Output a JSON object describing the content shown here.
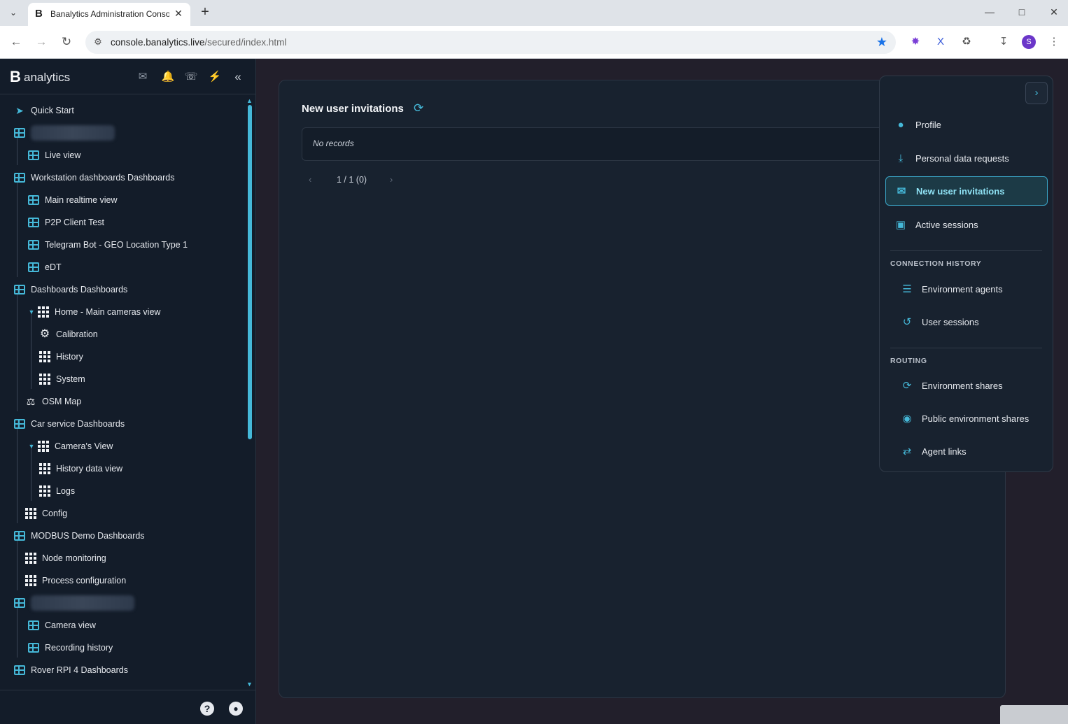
{
  "browser": {
    "tab_title": "Banalytics Administration Conso",
    "tab_favicon": "B",
    "url_host": "console.banalytics.live",
    "url_path": "/secured/index.html",
    "profile_initial": "S"
  },
  "sidebar": {
    "brand_mark": "B",
    "brand_text": "analytics",
    "header_icons": [
      "mail-icon",
      "bell-icon",
      "phone-hangup-icon",
      "plug-icon",
      "collapse-double-chevron-icon"
    ],
    "items": [
      {
        "label": "Quick Start",
        "icon": "rocket-icon"
      },
      {
        "label": "",
        "icon": "table-icon",
        "blurred": true
      },
      {
        "label": "Live view",
        "icon": "table-icon"
      },
      {
        "label": "Workstation dashboards Dashboards",
        "icon": "table-icon"
      },
      {
        "label": "Main realtime view",
        "icon": "table-icon"
      },
      {
        "label": "P2P Client Test",
        "icon": "table-icon"
      },
      {
        "label": "Telegram Bot - GEO Location Type 1",
        "icon": "table-icon"
      },
      {
        "label": "eDT",
        "icon": "table-icon"
      },
      {
        "label": "Dashboards Dashboards",
        "icon": "table-icon"
      },
      {
        "label": "Home - Main cameras view",
        "icon": "grid-icon",
        "expanded": true
      },
      {
        "label": "Calibration",
        "icon": "gear-icon"
      },
      {
        "label": "History",
        "icon": "grid-icon"
      },
      {
        "label": "System",
        "icon": "grid-icon"
      },
      {
        "label": "OSM Map",
        "icon": "map-icon"
      },
      {
        "label": "Car service Dashboards",
        "icon": "table-icon"
      },
      {
        "label": "Camera's View",
        "icon": "grid-icon",
        "expanded": true
      },
      {
        "label": "History data view",
        "icon": "grid-icon"
      },
      {
        "label": "Logs",
        "icon": "grid-icon"
      },
      {
        "label": "Config",
        "icon": "grid-icon"
      },
      {
        "label": "MODBUS Demo Dashboards",
        "icon": "table-icon"
      },
      {
        "label": "Node monitoring",
        "icon": "grid-icon"
      },
      {
        "label": "Process configuration",
        "icon": "grid-icon"
      },
      {
        "label": "",
        "icon": "table-icon",
        "blurred": true
      },
      {
        "label": "Camera view",
        "icon": "table-icon"
      },
      {
        "label": "Recording history",
        "icon": "table-icon"
      },
      {
        "label": "Rover RPI 4 Dashboards",
        "icon": "table-icon"
      }
    ],
    "footer_icons": [
      "help-icon",
      "user-account-icon"
    ]
  },
  "main": {
    "title": "New user invitations",
    "empty_text": "No records",
    "pager": "1 / 1 (0)"
  },
  "menu": {
    "items": [
      {
        "label": "Profile",
        "icon": "user-circle-icon"
      },
      {
        "label": "Personal data requests",
        "icon": "download-icon"
      },
      {
        "label": "New user invitations",
        "icon": "envelope-icon",
        "active": true
      },
      {
        "label": "Active sessions",
        "icon": "monitor-icon"
      }
    ],
    "sections": [
      {
        "title": "CONNECTION HISTORY",
        "items": [
          {
            "label": "Environment agents",
            "icon": "server-icon"
          },
          {
            "label": "User sessions",
            "icon": "history-icon"
          }
        ]
      },
      {
        "title": "ROUTING",
        "items": [
          {
            "label": "Environment shares",
            "icon": "share-icon"
          },
          {
            "label": "Public environment shares",
            "icon": "globe-icon"
          },
          {
            "label": "Agent links",
            "icon": "arrows-exchange-icon"
          }
        ]
      }
    ]
  },
  "colors": {
    "accent": "#45b8d8",
    "sidebar_bg": "#131c29",
    "panel_bg": "#18222f",
    "bell": "#ef3b3b",
    "plug": "#4cc76a"
  }
}
